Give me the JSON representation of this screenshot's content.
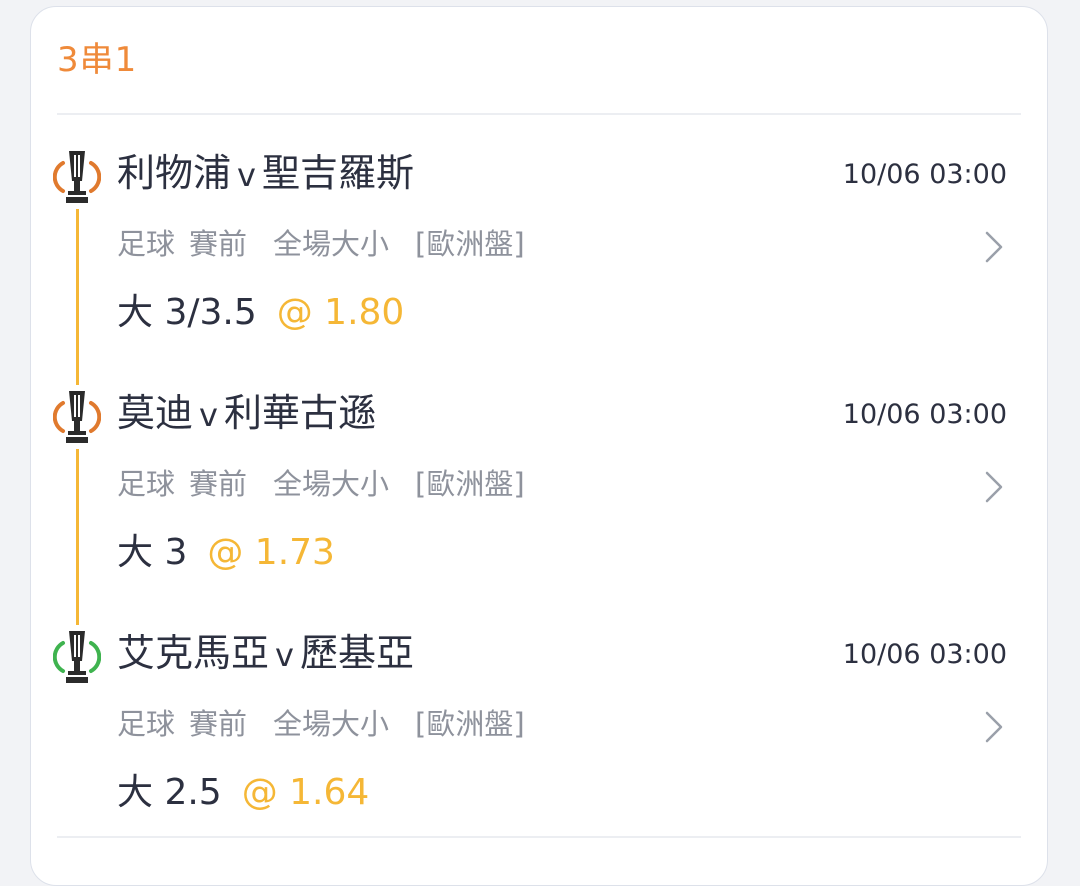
{
  "bet_slip": {
    "title": "3串1",
    "accent_color": "#ef8a3a",
    "odds_color": "#f5b736",
    "legs": [
      {
        "team_home": "利物浦",
        "separator": "v",
        "team_away": "聖吉羅斯",
        "time": "10/06 03:00",
        "sport": "足球",
        "stage": "賽前",
        "market": "全場大小",
        "odds_format": "[歐洲盤]",
        "selection": "大 3/3.5",
        "odds": "@ 1.80",
        "competition_icon": "trophy-icon",
        "icon_color": "#e07a2e"
      },
      {
        "team_home": "莫迪",
        "separator": "v",
        "team_away": "利華古遜",
        "time": "10/06 03:00",
        "sport": "足球",
        "stage": "賽前",
        "market": "全場大小",
        "odds_format": "[歐洲盤]",
        "selection": "大 3",
        "odds": "@ 1.73",
        "competition_icon": "trophy-icon",
        "icon_color": "#e07a2e"
      },
      {
        "team_home": "艾克馬亞",
        "separator": "v",
        "team_away": "歷基亞",
        "time": "10/06 03:00",
        "sport": "足球",
        "stage": "賽前",
        "market": "全場大小",
        "odds_format": "[歐洲盤]",
        "selection": "大 2.5",
        "odds": "@ 1.64",
        "competition_icon": "trophy-icon",
        "icon_color": "#3fb34f"
      }
    ]
  }
}
